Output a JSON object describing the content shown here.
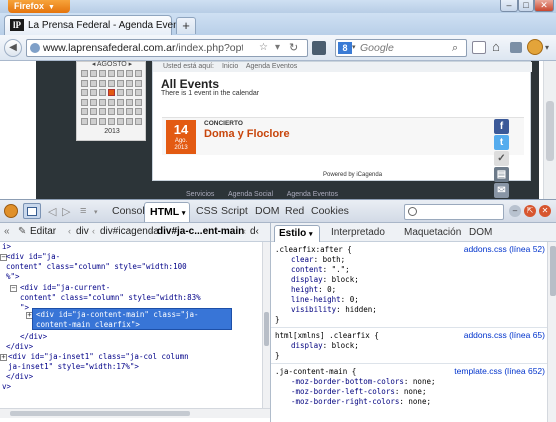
{
  "window": {
    "firefox_button": "Firefox",
    "controls": [
      "–",
      "□",
      "✕"
    ]
  },
  "tabs": [
    {
      "favicon": "lP",
      "title": "La Prensa Federal - Agenda Eventos"
    }
  ],
  "new_tab": "+",
  "nav": {
    "url_domain": "www.laprensafederal.com.ar",
    "url_path": "/index.php?option=com_icagenda",
    "search_engine": "8",
    "search_placeholder": "Google"
  },
  "page": {
    "calendar": {
      "month_label": "AGOSTO",
      "year": "2013",
      "highlight_color": "#e35a12"
    },
    "breadcrumb": [
      "Usted está aquí:",
      "Inicio",
      "Agenda Eventos"
    ],
    "heading": "All Events",
    "count_text": "There is 1 event in the calendar",
    "event": {
      "day": "14",
      "month": "Ago.",
      "year": "2013",
      "category": "CONCIERTO",
      "title": "Doma y Floclore"
    },
    "powered_by": "Powered by iCagenda",
    "footer_links": [
      "Servicios",
      "Agenda Social",
      "Agenda Eventos"
    ],
    "share_icons": [
      "facebook-icon",
      "twitter-icon",
      "share-icon",
      "print-icon",
      "email-icon"
    ]
  },
  "firebug": {
    "tabs": [
      "Consola",
      "HTML",
      "CSS",
      "Script",
      "DOM",
      "Red",
      "Cookies"
    ],
    "active_tab": "HTML",
    "breadcrumb": {
      "edit_label": "Editar",
      "items": [
        "div",
        "div#icagenda",
        "div#ja-c...ent-main",
        "d‹"
      ]
    },
    "tree": [
      {
        "text": "i>"
      },
      {
        "tag": "<div",
        "attrs": [
          [
            "id",
            "\"ja-"
          ],
          [
            "content\" class",
            "\"column\""
          ],
          [
            "style",
            "\"width:100"
          ]
        ],
        "raw": "<div id=\"ja-",
        "raw2": "content\" class=\"column\" style=\"width:100",
        "raw3": "%\">"
      },
      {
        "raw": "<div id=\"ja-current-",
        "raw2": "content\" class=\"column\" style=\"width:83%",
        "raw3": "\">"
      },
      {
        "raw": "<div id=\"ja-content-main\" class=\"ja-",
        "raw2": "content-main clearfix\">"
      },
      {
        "raw": "</div>"
      },
      {
        "raw": "</div>"
      },
      {
        "raw": "<div id=\"ja-inset1\" class=\"ja-col column",
        "raw2": "ja-inset1\" style=\"width:17%\">"
      },
      {
        "raw": "</div>"
      },
      {
        "raw": "v>"
      }
    ],
    "side_tabs": [
      "Estilo",
      "Interpretado",
      "Maquetación",
      "DOM"
    ],
    "css_rules": [
      {
        "selector": ".clearfix:after {",
        "source": "addons.css (línea 52)",
        "props": [
          [
            "clear",
            "both;"
          ],
          [
            "content",
            "\".\";"
          ],
          [
            "display",
            "block;"
          ],
          [
            "height",
            "0;"
          ],
          [
            "line-height",
            "0;"
          ],
          [
            "visibility",
            "hidden;"
          ]
        ]
      },
      {
        "selector": "html[xmlns] .clearfix {",
        "source": "addons.css (línea 65)",
        "props": [
          [
            "display",
            "block;"
          ]
        ]
      },
      {
        "selector": ".ja-content-main {",
        "source": "template.css (línea 652)",
        "props": [
          [
            "-moz-border-bottom-colors",
            "none;"
          ],
          [
            "-moz-border-left-colors",
            "none;"
          ],
          [
            "-moz-border-right-colors",
            "none;"
          ]
        ]
      }
    ]
  }
}
